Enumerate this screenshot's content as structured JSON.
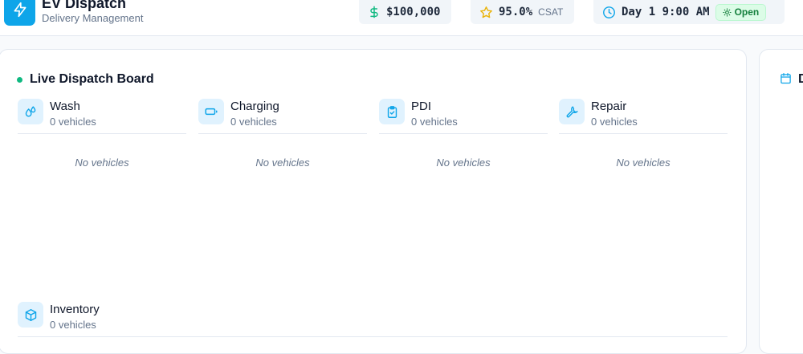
{
  "header": {
    "app_title": "EV Dispatch",
    "app_subtitle": "Delivery Management",
    "logo_icon": "lightning-bolt-icon",
    "money": "$100,000",
    "csat_value": "95.0%",
    "csat_label": "CSAT",
    "time": "Day 1 9:00 AM",
    "status": "Open"
  },
  "board": {
    "title": "Live Dispatch Board",
    "columns": [
      {
        "name": "Wash",
        "count": "0 vehicles",
        "empty": "No vehicles",
        "icon": "droplets-icon"
      },
      {
        "name": "Charging",
        "count": "0 vehicles",
        "empty": "No vehicles",
        "icon": "battery-icon"
      },
      {
        "name": "PDI",
        "count": "0 vehicles",
        "empty": "No vehicles",
        "icon": "clipboard-check-icon"
      },
      {
        "name": "Repair",
        "count": "0 vehicles",
        "empty": "No vehicles",
        "icon": "wrench-icon"
      },
      {
        "name": "Inventory",
        "count": "0 vehicles",
        "icon": "package-icon"
      }
    ]
  },
  "side_panel": {
    "title_fragment": "D",
    "icon": "calendar-icon"
  },
  "colors": {
    "accent": "#0ea5e9",
    "live": "#10b981",
    "open_badge_bg": "#dcfce7",
    "open_badge_text": "#15803d"
  }
}
